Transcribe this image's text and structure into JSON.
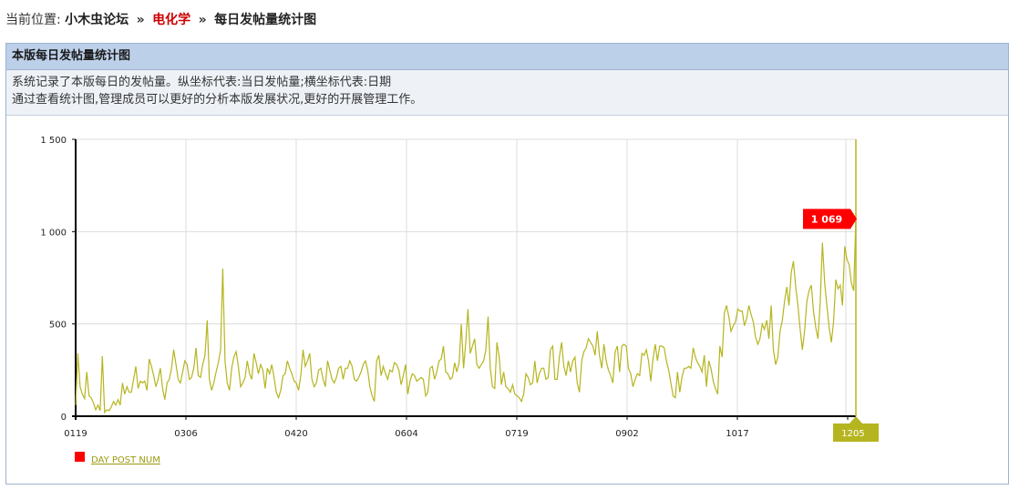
{
  "breadcrumb": {
    "prefix": "当前位置:",
    "home": "小木虫论坛",
    "sep1": "»",
    "forum": "电化学",
    "sep2": "»",
    "current": "每日发帖量统计图"
  },
  "panel": {
    "title": "本版每日发帖量统计图",
    "desc_line1": "系统记录了本版每日的发帖量。纵坐标代表:当日发帖量;横坐标代表:日期",
    "desc_line2": "通过查看统计图,管理成员可以更好的分析本版发展状况,更好的开展管理工作。"
  },
  "colors": {
    "line": "#b5b520",
    "marker": "#ff0000",
    "highlight_label_bg": "#b5b520"
  },
  "chart_data": {
    "type": "line",
    "title": "",
    "xlabel": "",
    "ylabel": "",
    "ylim": [
      0,
      1500
    ],
    "yticks": [
      0,
      500,
      1000,
      1500
    ],
    "ytick_labels": [
      "0",
      "500",
      "1 000",
      "1 500"
    ],
    "xtick_labels": [
      "0119",
      "0306",
      "0420",
      "0604",
      "0719",
      "0902",
      "1017",
      "1205"
    ],
    "grid": true,
    "legend": {
      "position": "bottom-left",
      "label": "DAY POST NUM"
    },
    "last_value_label": "1 069",
    "series": [
      {
        "name": "DAY POST NUM",
        "values": [
          60,
          340,
          160,
          120,
          95,
          240,
          110,
          100,
          70,
          35,
          60,
          30,
          325,
          20,
          35,
          30,
          50,
          80,
          60,
          90,
          60,
          180,
          120,
          160,
          130,
          130,
          200,
          270,
          150,
          190,
          180,
          190,
          140,
          310,
          270,
          220,
          160,
          200,
          260,
          150,
          90,
          180,
          200,
          260,
          360,
          280,
          200,
          180,
          240,
          300,
          280,
          200,
          210,
          260,
          370,
          220,
          210,
          280,
          330,
          520,
          200,
          140,
          180,
          240,
          290,
          360,
          800,
          300,
          180,
          140,
          260,
          320,
          350,
          270,
          160,
          180,
          210,
          300,
          230,
          200,
          340,
          290,
          230,
          280,
          250,
          150,
          260,
          230,
          280,
          210,
          130,
          100,
          140,
          220,
          230,
          300,
          260,
          230,
          190,
          180,
          140,
          220,
          360,
          270,
          300,
          340,
          200,
          160,
          180,
          250,
          260,
          200,
          160,
          300,
          250,
          200,
          180,
          210,
          260,
          270,
          200,
          260,
          260,
          300,
          270,
          200,
          190,
          210,
          240,
          280,
          300,
          250,
          160,
          110,
          80,
          300,
          330,
          220,
          270,
          230,
          200,
          250,
          240,
          290,
          280,
          250,
          170,
          220,
          280,
          120,
          190,
          230,
          220,
          190,
          200,
          210,
          200,
          110,
          130,
          260,
          270,
          200,
          240,
          300,
          310,
          380,
          240,
          230,
          200,
          210,
          290,
          240,
          290,
          500,
          260,
          400,
          580,
          340,
          380,
          420,
          280,
          260,
          280,
          300,
          360,
          540,
          260,
          160,
          150,
          400,
          320,
          170,
          240,
          160,
          150,
          130,
          170,
          120,
          110,
          100,
          80,
          120,
          230,
          210,
          170,
          180,
          300,
          180,
          230,
          260,
          260,
          200,
          210,
          360,
          380,
          200,
          200,
          320,
          400,
          270,
          220,
          300,
          240,
          300,
          320,
          180,
          130,
          300,
          350,
          370,
          420,
          400,
          380,
          330,
          460,
          330,
          260,
          390,
          300,
          250,
          220,
          180,
          350,
          380,
          240,
          380,
          390,
          380,
          260,
          230,
          160,
          200,
          230,
          220,
          340,
          330,
          360,
          300,
          190,
          310,
          390,
          300,
          380,
          380,
          370,
          300,
          250,
          180,
          110,
          100,
          240,
          130,
          210,
          260,
          260,
          270,
          260,
          370,
          320,
          290,
          270,
          240,
          330,
          160,
          300,
          260,
          190,
          150,
          120,
          380,
          320,
          560,
          600,
          540,
          460,
          490,
          510,
          580,
          570,
          570,
          490,
          530,
          600,
          550,
          510,
          430,
          390,
          420,
          500,
          470,
          520,
          420,
          600,
          360,
          280,
          320,
          460,
          520,
          620,
          700,
          600,
          780,
          840,
          700,
          600,
          470,
          360,
          460,
          620,
          680,
          710,
          570,
          480,
          420,
          620,
          940,
          720,
          600,
          480,
          400,
          510,
          740,
          690,
          710,
          600,
          920,
          850,
          820,
          720,
          680,
          1069
        ]
      }
    ]
  }
}
